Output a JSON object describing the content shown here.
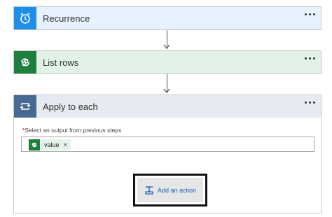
{
  "steps": [
    {
      "title": "Recurrence",
      "icon": "alarm-clock-icon",
      "color": "#1f8ee8",
      "header_bg": "#e6f2fd"
    },
    {
      "title": "List rows",
      "icon": "dataverse-icon",
      "color": "#1d7f3b",
      "header_bg": "#e2f2e9"
    },
    {
      "title": "Apply to each",
      "icon": "loop-icon",
      "color": "#486991",
      "header_bg": "#e6ebf2"
    }
  ],
  "apply_each": {
    "required_label": "Select an output from previous steps",
    "required_marker": "*",
    "token_label": "value",
    "token_remove": "×",
    "add_action_label": "Add an action"
  }
}
